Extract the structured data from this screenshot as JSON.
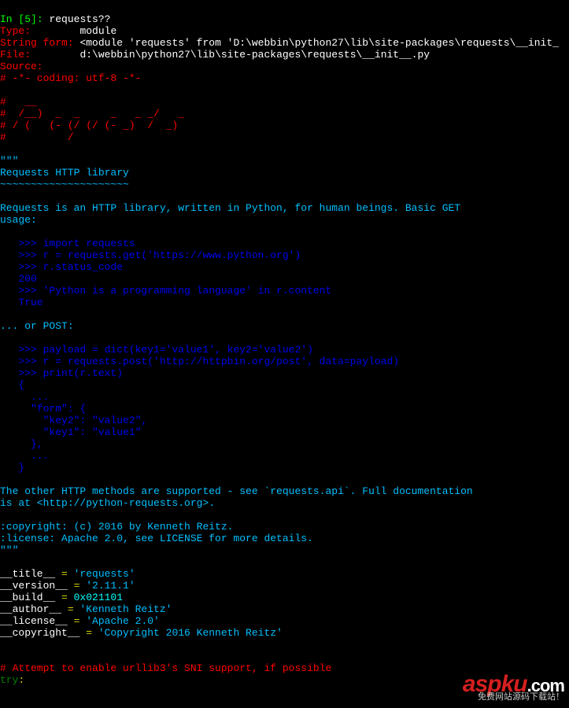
{
  "prompt": {
    "in": "In ",
    "bracket_open": "[",
    "num": "5",
    "bracket_close": "]",
    "colon": ": ",
    "cmd": "requests??"
  },
  "header": {
    "type_label": "Type:",
    "type_value": "module",
    "string_form_label": "String form:",
    "string_form_value": "<module 'requests' from 'D:\\webbin\\python27\\lib\\site-packages\\requests\\__init_",
    "file_label": "File:",
    "file_value": "d:\\webbin\\python27\\lib\\site-packages\\requests\\__init__.py",
    "source_label": "Source:"
  },
  "source": {
    "line1": "# -*- coding: utf-8 -*-",
    "ascii1": "#   __",
    "ascii2": "#  /__)  _  _     _   _ _/   _",
    "ascii3": "# / (   (- (/ (/ (- _)  /  _)",
    "ascii4": "#          /",
    "doc_open": "\"\"\"",
    "doc_title": "Requests HTTP library",
    "doc_underline": "~~~~~~~~~~~~~~~~~~~~~",
    "doc_p1a": "Requests is an HTTP library, written in Python, for human beings. Basic GET",
    "doc_p1b": "usage:",
    "ex1_l1": "   >>> import requests",
    "ex1_l2": "   >>> r = requests.get('https://www.python.org')",
    "ex1_l3": "   >>> r.status_code",
    "ex1_l4": "   200",
    "ex1_l5": "   >>> 'Python is a programming language' in r.content",
    "ex1_l6": "   True",
    "doc_p2": "... or POST:",
    "ex2_l1": "   >>> payload = dict(key1='value1', key2='value2')",
    "ex2_l2": "   >>> r = requests.post('http://httpbin.org/post', data=payload)",
    "ex2_l3": "   >>> print(r.text)",
    "ex2_l4": "   {",
    "ex2_l5": "     ...",
    "ex2_l6": "     \"form\": {",
    "ex2_l7": "       \"key2\": \"value2\",",
    "ex2_l8": "       \"key1\": \"value1\"",
    "ex2_l9": "     },",
    "ex2_l10": "     ...",
    "ex2_l11": "   }",
    "doc_p3a": "The other HTTP methods are supported - see `requests.api`. Full documentation",
    "doc_p3b": "is at <http://python-requests.org>.",
    "copyright_line": ":copyright: (c) 2016 by Kenneth Reitz.",
    "license_line": ":license: Apache 2.0, see LICENSE for more details.",
    "doc_close": "\"\"\"",
    "assign": {
      "title_name": "__title__",
      "title_val": "'requests'",
      "version_name": "__version__",
      "version_val": "'2.11.1'",
      "build_name": "__build__",
      "build_val": "0x021101",
      "author_name": "__author__",
      "author_val": "'Kenneth Reitz'",
      "license_name": "__license__",
      "license_val": "'Apache 2.0'",
      "copyright_name": "__copyright__",
      "copyright_val": "'Copyright 2016 Kenneth Reitz'"
    },
    "comment2": "# Attempt to enable urllib3's SNI support, if possible",
    "try_kw": "try",
    "colon": ":"
  },
  "eq": " = ",
  "watermark": {
    "logo_main": "aspku",
    "logo_dot": ".",
    "logo_com": "com",
    "tagline": "免费网站源码下载站！"
  }
}
